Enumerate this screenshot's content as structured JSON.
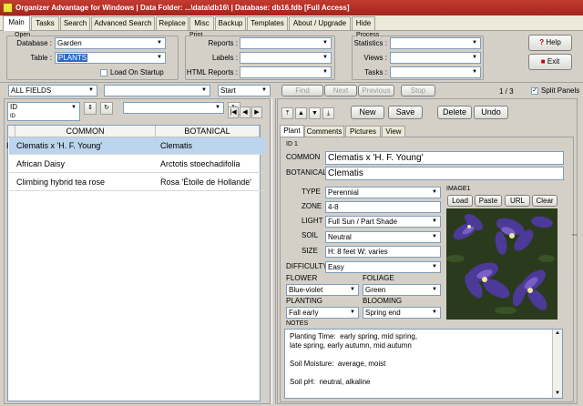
{
  "window": {
    "title": "Organizer Advantage for Windows | Data Folder: ...\\data\\db16\\ | Database: db16.fdb [Full Access]"
  },
  "menu": {
    "tabs": [
      "Main",
      "Tasks",
      "Search",
      "Advanced Search",
      "Replace",
      "Misc",
      "Backup",
      "Templates",
      "About / Upgrade",
      "Hide"
    ]
  },
  "open_group": {
    "title": "Open",
    "database_label": "Database :",
    "database_value": "Garden",
    "table_label": "Table :",
    "table_value": "PLANTS",
    "load_on_startup": "Load On Startup"
  },
  "print_group": {
    "title": "Print",
    "reports_label": "Reports :",
    "labels_label": "Labels :",
    "html_reports_label": "HTML Reports :"
  },
  "process_group": {
    "title": "Process",
    "statistics_label": "Statistics :",
    "views_label": "Views :",
    "tasks_label": "Tasks :"
  },
  "help_button": "Help",
  "exit_button": "Exit",
  "search_bar": {
    "field_value": "ALL FIELDS",
    "mode_value": "Start",
    "find": "Find",
    "next": "Next",
    "previous": "Previous",
    "stop": "Stop",
    "record_counter": "1 / 3",
    "split_panels": "Split Panels"
  },
  "sort": {
    "field_value": "ID",
    "sub_label": "ID"
  },
  "grid": {
    "columns": [
      "COMMON",
      "BOTANICAL"
    ],
    "rows": [
      {
        "common": "Clematis x 'H. F. Young'",
        "botanical": "Clematis",
        "selected": true
      },
      {
        "common": "African Daisy",
        "botanical": "Arctotis stoechadifolia",
        "selected": false
      },
      {
        "common": "Climbing hybrid tea rose",
        "botanical": "Rosa 'Étoile de Hollande'",
        "selected": false
      }
    ],
    "row_marker": "I"
  },
  "record_buttons": {
    "new": "New",
    "save": "Save",
    "delete": "Delete",
    "undo": "Undo"
  },
  "detail_tabs": [
    "Plant",
    "Comments",
    "Pictures",
    "View"
  ],
  "record": {
    "id_label": "ID",
    "id_value": "1",
    "common_label": "COMMON",
    "common_value": "Clematis x 'H. F. Young'",
    "botanical_label": "BOTANICAL",
    "botanical_value": "Clematis",
    "type_label": "TYPE",
    "type_value": "Perennial",
    "zone_label": "ZONE",
    "zone_value": "4-8",
    "light_label": "LIGHT",
    "light_value": "Full Sun / Part Shade",
    "soil_label": "SOIL",
    "soil_value": "Neutral",
    "size_label": "SIZE",
    "size_value": "H: 8 feet  W: varies",
    "difficulty_label": "DIFFICULTY",
    "difficulty_value": "Easy",
    "flower_label": "FLOWER",
    "flower_value": "Blue-violet",
    "foliage_label": "FOLIAGE",
    "foliage_value": "Green",
    "planting_label": "PLANTING",
    "planting_value": "Fall early",
    "blooming_label": "BLOOMING",
    "blooming_value": "Spring end",
    "image_label": "IMAGE1",
    "image_buttons": {
      "load": "Load",
      "paste": "Paste",
      "url": "URL",
      "clear": "Clear"
    },
    "notes_label": "NOTES",
    "notes_value": "Planting Time:  early spring, mid spring,\nlate spring, early autumn, mid autumn\n\nSoil Moisture:  average, moist\n\nSoil pH:  neutral, alkaline"
  },
  "colors": {
    "title_bar": "#b22f27",
    "selected_row": "#bcd4ee",
    "flower_purple": "#6a4fb8"
  }
}
